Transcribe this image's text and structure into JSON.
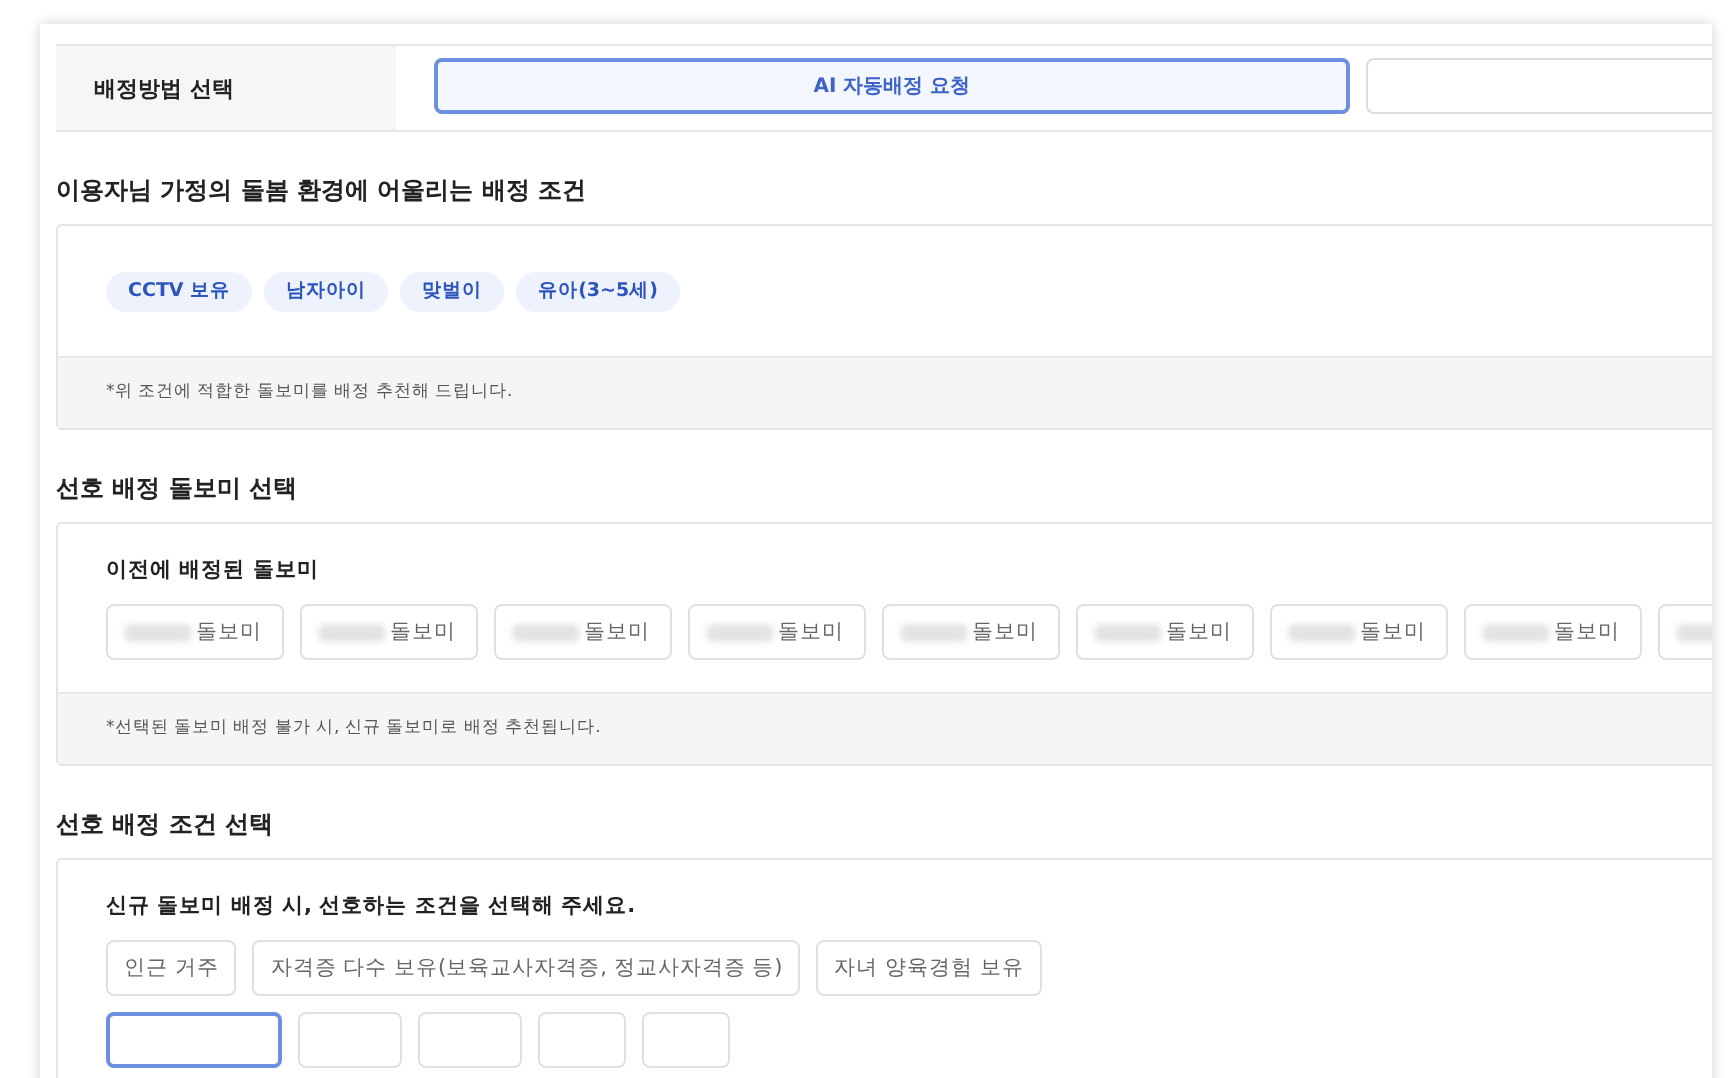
{
  "method": {
    "label": "배정방법 선택",
    "options": [
      {
        "label": "AI 자동배정 요청",
        "selected": true
      },
      {
        "selected": false
      }
    ]
  },
  "environment": {
    "title": "이용자님 가정의 돌봄 환경에 어울리는 배정 조건",
    "tags": [
      "CCTV 보유",
      "남자아이",
      "맞벌이",
      "유아(3~5세)"
    ],
    "note": "*위 조건에 적합한 돌보미를 배정 추천해 드립니다."
  },
  "caregivers": {
    "title": "선호 배정 돌보미 선택",
    "subtitle": "이전에 배정된 돌보미",
    "items": [
      {
        "label": "돌보미"
      },
      {
        "label": "돌보미"
      },
      {
        "label": "돌보미"
      },
      {
        "label": "돌보미"
      },
      {
        "label": "돌보미"
      },
      {
        "label": "돌보미"
      },
      {
        "label": "돌보미"
      },
      {
        "label": "돌보미"
      }
    ],
    "note": "*선택된 돌보미 배정 불가 시, 신규 돌보미로 배정 추천됩니다."
  },
  "conditions": {
    "title": "선호 배정 조건 선택",
    "subtitle": "신규 돌보미 배정 시, 선호하는 조건을 선택해 주세요.",
    "rows": [
      [
        {
          "label": "인근 거주",
          "selected": false
        },
        {
          "label": "자격증 다수 보유(보육교사자격증, 정교사자격증 등)",
          "selected": false
        },
        {
          "label": "자녀 양육경험 보유",
          "selected": false
        }
      ],
      [
        {
          "selected": true
        },
        {
          "selected": false
        },
        {
          "selected": false
        },
        {
          "selected": false
        },
        {
          "selected": false
        }
      ]
    ]
  }
}
